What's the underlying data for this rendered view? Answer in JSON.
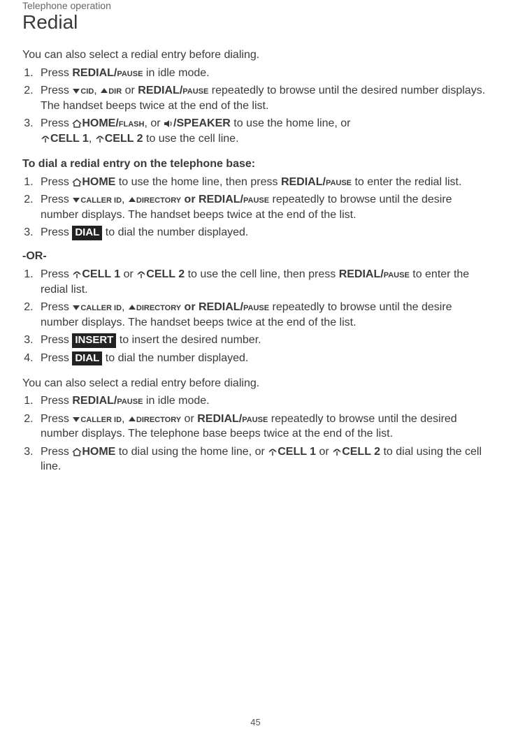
{
  "breadcrumb": "Telephone operation",
  "title": "Redial",
  "intro1": "You can also select a redial entry before dialing.",
  "labels": {
    "press": "Press ",
    "redial_pause": "REDIAL/",
    "redial_pause_sc": "PAUSE",
    "cid": "CID",
    "dir": "DIR",
    "caller_id": "CALLER ID",
    "directory": "DIRECTORY",
    "home_flash": "HOME/",
    "home_flash_sc": "FLASH",
    "speaker": "/SPEAKER",
    "home": "HOME",
    "cell1": "CELL 1",
    "cell2": "CELL 2",
    "dial_btn": "DIAL",
    "insert_btn": "INSERT",
    "or": "-OR-",
    "or_word": " or ",
    "comma_sp": ", "
  },
  "list1": {
    "s1_tail": " in idle mode.",
    "s2_tail": " repeatedly to browse until the desired number displays. The handset beeps twice at the end of the list.",
    "s3_mid": " to use the home line, or ",
    "s3_tail": " to use the cell line."
  },
  "heading2": "To dial a redial entry on the telephone base:",
  "list2": {
    "s1_mid": " to use the home line, then press ",
    "s1_tail": " to enter the redial list.",
    "s2_tail": " repeatedly to browse until the desire number displays. The handset beeps twice at the end of the list.",
    "s3_tail": " to dial the number displayed."
  },
  "list3": {
    "s1_mid": " to use the cell line, then press ",
    "s1_tail": " to enter the redial list.",
    "s2_tail": " repeatedly to browse until the desire number displays. The handset beeps twice at the end of the list.",
    "s3_tail": " to insert the desired number.",
    "s4_tail": " to dial the number displayed."
  },
  "intro2": "You can also select a redial entry before dialing.",
  "list4": {
    "s1_tail": " in idle mode.",
    "s2_tail": " repeatedly to browse until the desired number displays. The telephone base beeps twice at the end of the list.",
    "s3_mid": " to dial using the home line, or ",
    "s3_tail": " to dial using the cell line."
  },
  "page_number": "45"
}
